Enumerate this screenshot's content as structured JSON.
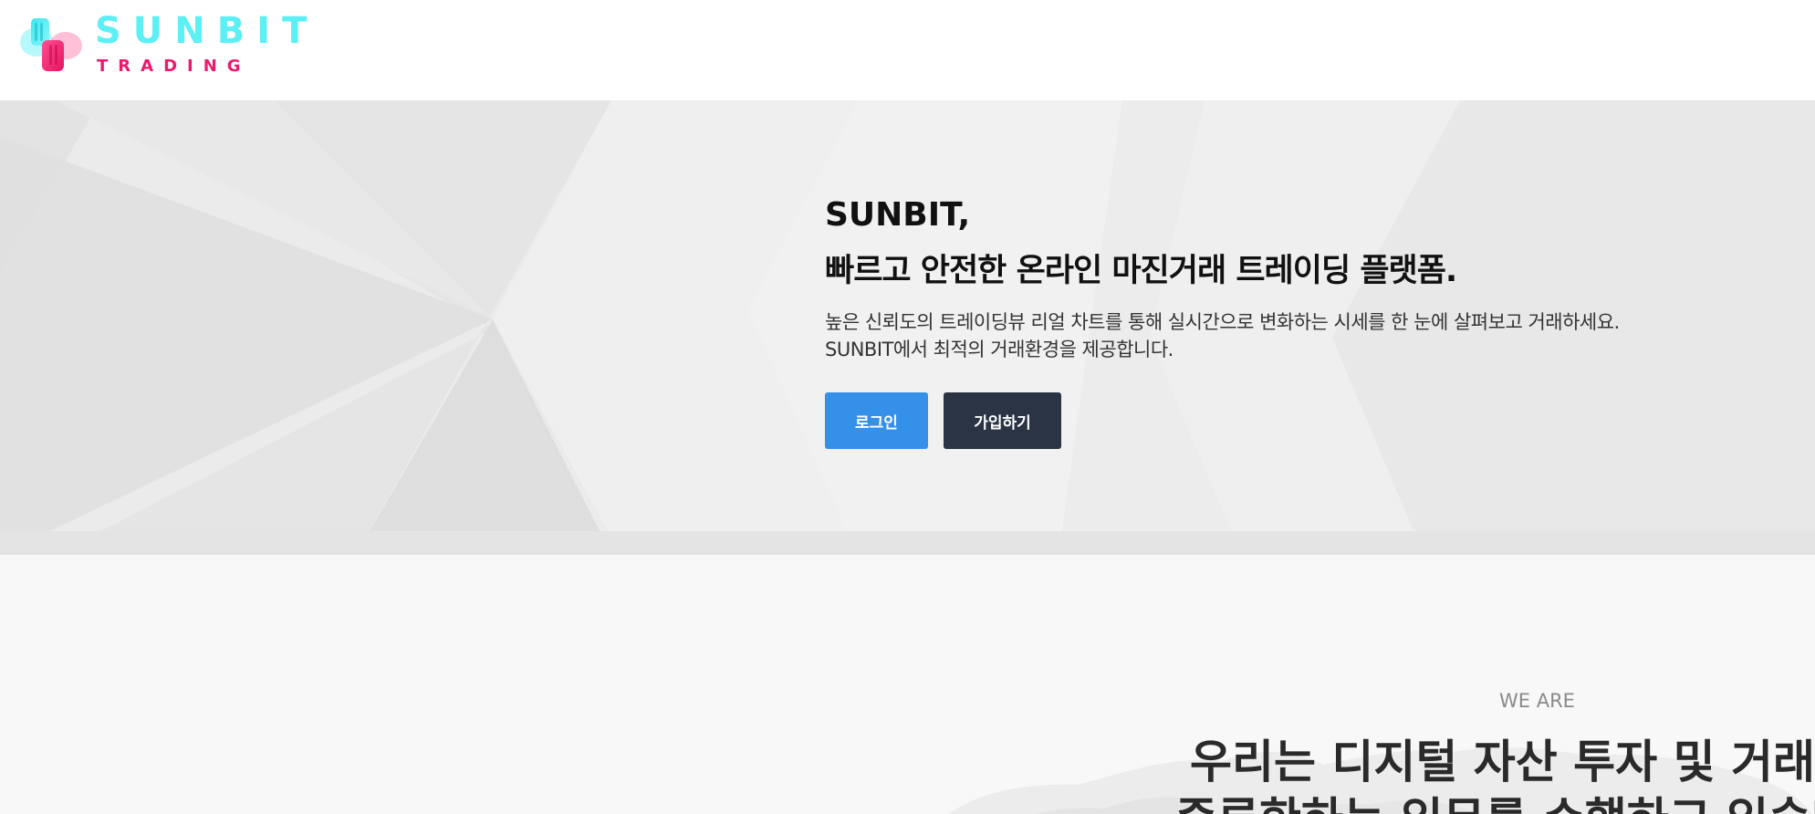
{
  "header": {
    "logo_word": "SUNBIT",
    "logo_sub": "TRADING"
  },
  "hero": {
    "title": "SUNBIT,",
    "subtitle": "빠르고 안전한 온라인 마진거래 트레이딩 플랫폼.",
    "description": "높은 신뢰도의 트레이딩뷰 리얼 차트를 통해 실시간으로 변화하는 시세를 한 눈에 살펴보고 거래하세요. SUNBIT에서 최적의 거래환경을 제공합니다.",
    "login_label": "로그인",
    "signup_label": "가입하기"
  },
  "about": {
    "eyebrow": "WE ARE",
    "title_line1": "우리는 디지털 자산 투자 및 거래",
    "title_line2": "중류한하는 임무를 수행하고 있습니"
  },
  "colors": {
    "logo_cyan": "#5cf0f4",
    "logo_pink": "#f0186c",
    "login_button": "#3590ea",
    "signup_button": "#2b3445",
    "hero_bg": "#e9e9e9",
    "about_bg": "#f8f8f8"
  }
}
